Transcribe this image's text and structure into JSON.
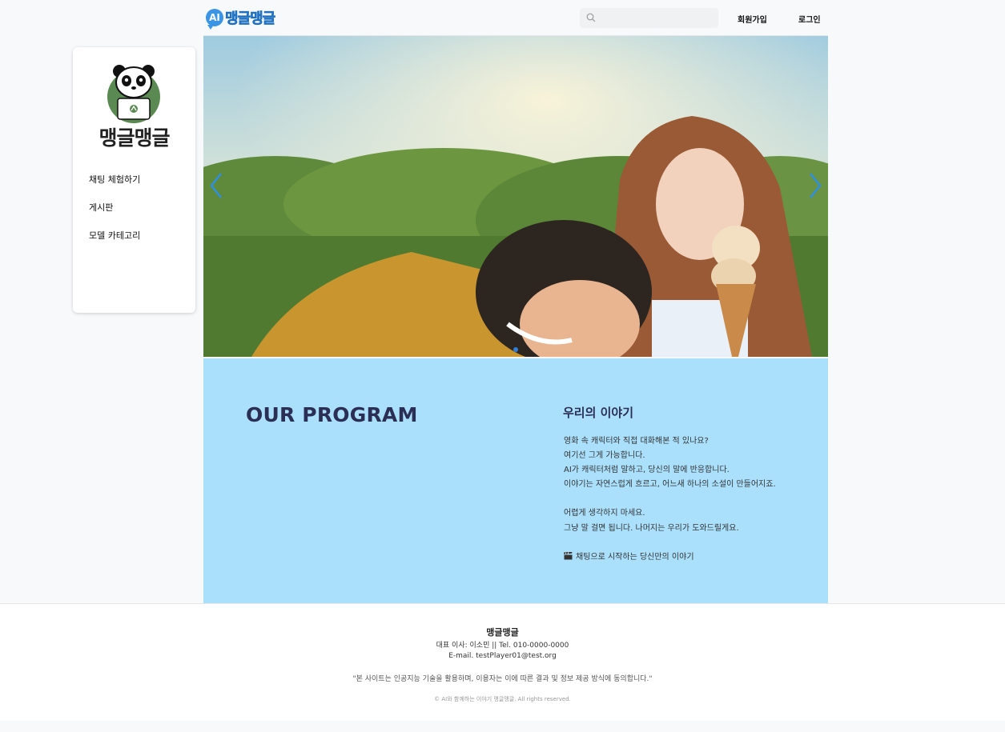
{
  "header": {
    "logo_ai": "AI",
    "logo_text": "맹글맹글",
    "search_placeholder": "",
    "signup_label": "회원가입",
    "login_label": "로그인"
  },
  "sidebar": {
    "brand_name": "맹글맹글",
    "items": [
      {
        "label": "채팅 체험하기"
      },
      {
        "label": "게시판"
      },
      {
        "label": "모델 카테고리"
      }
    ]
  },
  "banner": {
    "slide_count": 1,
    "active_slide": 1
  },
  "program": {
    "title": "OUR PROGRAM",
    "story_title": "우리의 이야기",
    "lines": [
      "영화 속 캐릭터와 직접 대화해본 적 있나요?",
      "여기선 그게 가능합니다.",
      "AI가 캐릭터처럼 말하고, 당신의 말에 반응합니다.",
      "이야기는 자연스럽게 흐르고, 어느새 하나의 소설이 만들어지죠.",
      "어렵게 생각하지 마세요.",
      "그냥 말 걸면 됩니다. 나머지는 우리가 도와드릴게요."
    ],
    "cta": "채팅으로 시작하는 당신만의 이야기"
  },
  "footer": {
    "brand": "맹글맹글",
    "ceo_line": "대표 이사: 이소민 || Tel. 010-0000-0000",
    "email_line": "E-mail. testPlayer01@test.org",
    "notice": "\"본 사이트는 인공지능 기술을 활용하며, 이용자는 이에 따른 결과 및 정보 제공 방식에 동의합니다.\"",
    "copyright": "© AI와 함께하는 이야기 맹글맹글. All rights reserved."
  },
  "colors": {
    "program_bg": "#aae0fc",
    "program_title": "#2b2f55",
    "accent": "#3b95e6",
    "panda_circle": "#5a8a52"
  }
}
